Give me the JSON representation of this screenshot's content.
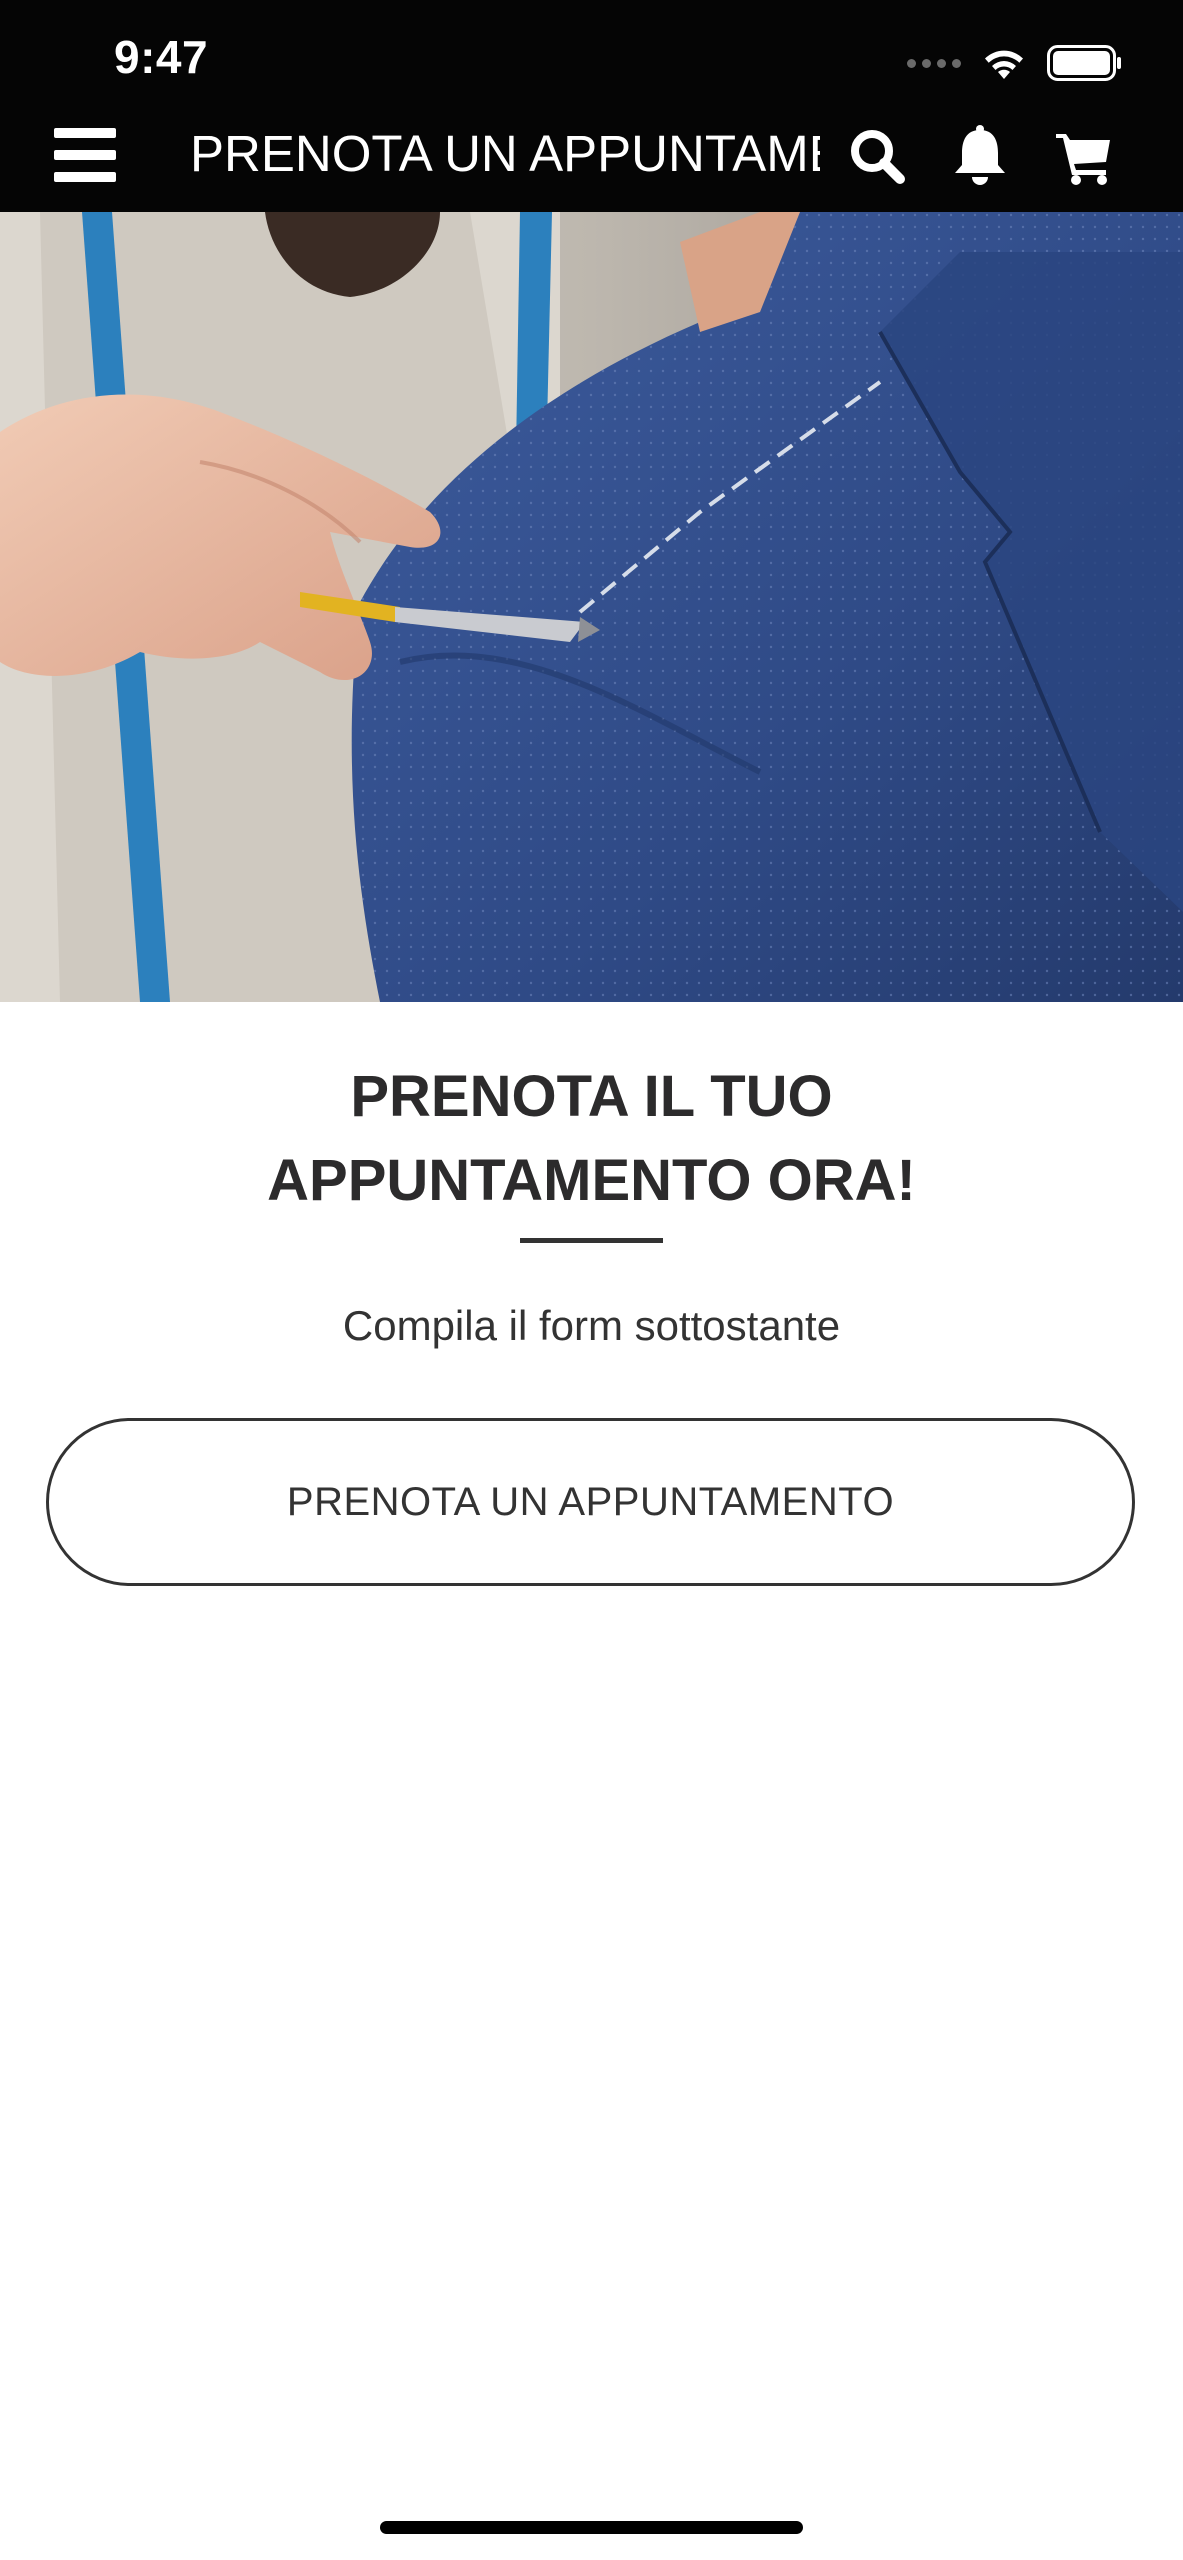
{
  "status_bar": {
    "time": "9:47"
  },
  "app_bar": {
    "title": "PRENOTA UN APPUNTAMENTO",
    "icons": [
      "menu-icon",
      "search-icon",
      "bell-icon",
      "cart-icon"
    ]
  },
  "hero": {
    "description_icon": "tailor-image"
  },
  "content": {
    "heading_line1": "PRENOTA IL TUO",
    "heading_line2": "APPUNTAMENTO ORA!",
    "subtitle": "Compila il form sottostante",
    "button_label": "PRENOTA UN APPUNTAMENTO"
  },
  "colors": {
    "header_bg": "#050505",
    "text_dark": "#2c2b2c",
    "jacket_blue": "#2f4a86"
  }
}
